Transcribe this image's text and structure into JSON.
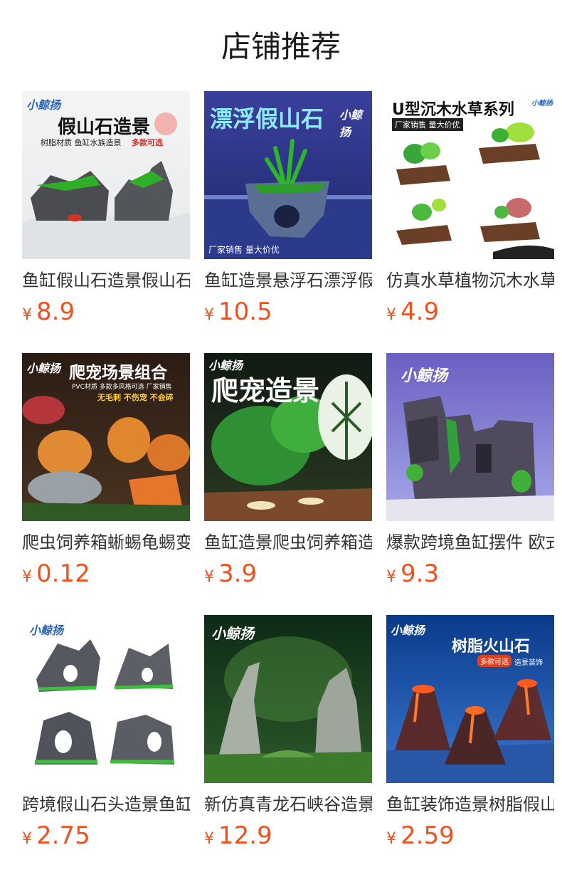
{
  "header": {
    "title": "店铺推荐"
  },
  "products": [
    {
      "name": "鱼缸假山石造景假山石",
      "currency": "¥",
      "price": "8.9",
      "image": {
        "brand": "小鲸扬",
        "headline": "假山石造景",
        "tagline_a": "树脂材质 鱼缸水族造景",
        "tagline_b": "多款可选",
        "accent": "#2d8a2a"
      }
    },
    {
      "name": "鱼缸造景悬浮石漂浮假山",
      "currency": "¥",
      "price": "10.5",
      "image": {
        "brand": "小鲸扬",
        "headline": "漂浮假山石",
        "footer": "厂家销售  量大价优",
        "accent": "#4b6cd1"
      }
    },
    {
      "name": "仿真水草植物沉木水草摆件",
      "currency": "¥",
      "price": "4.9",
      "image": {
        "brand": "小鲸扬",
        "headline": "U型沉木水草系列",
        "tagline_a": "厂家销售  量大价优",
        "accent": "#6c8f2a"
      }
    },
    {
      "name": "爬虫饲养箱蜥蜴龟蜴变色龙",
      "currency": "¥",
      "price": "0.12",
      "image": {
        "brand": "小鲸扬",
        "headline": "爬宠场景组合",
        "tagline_a": "PVC材质  多款多风格可选  厂家销售",
        "tagline_b": "无毛刺  不伤宠  不会碎",
        "accent": "#e2762a"
      }
    },
    {
      "name": "鱼缸造景爬虫饲养箱造景",
      "currency": "¥",
      "price": "3.9",
      "image": {
        "brand": "小鲸扬",
        "headline": "爬宠造景",
        "accent": "#2e8a34"
      }
    },
    {
      "name": "爆款跨境鱼缸摆件 欧式城堡",
      "currency": "¥",
      "price": "9.3",
      "image": {
        "brand": "小鲸扬",
        "accent": "#6b62a8"
      }
    },
    {
      "name": "跨境假山石头造景鱼缸摆件",
      "currency": "¥",
      "price": "2.75",
      "image": {
        "brand": "小鲸扬",
        "accent": "#4a4f55"
      }
    },
    {
      "name": "新仿真青龙石峡谷造景",
      "currency": "¥",
      "price": "12.9",
      "image": {
        "brand": "小鲸扬",
        "accent": "#2f6a3b"
      }
    },
    {
      "name": "鱼缸装饰造景树脂假山火山石",
      "currency": "¥",
      "price": "2.59",
      "image": {
        "brand": "小鲸扬",
        "headline": "树脂火山石",
        "tagline_a": "多款可选",
        "tagline_b": "造景装饰",
        "accent": "#e2451f"
      }
    }
  ]
}
